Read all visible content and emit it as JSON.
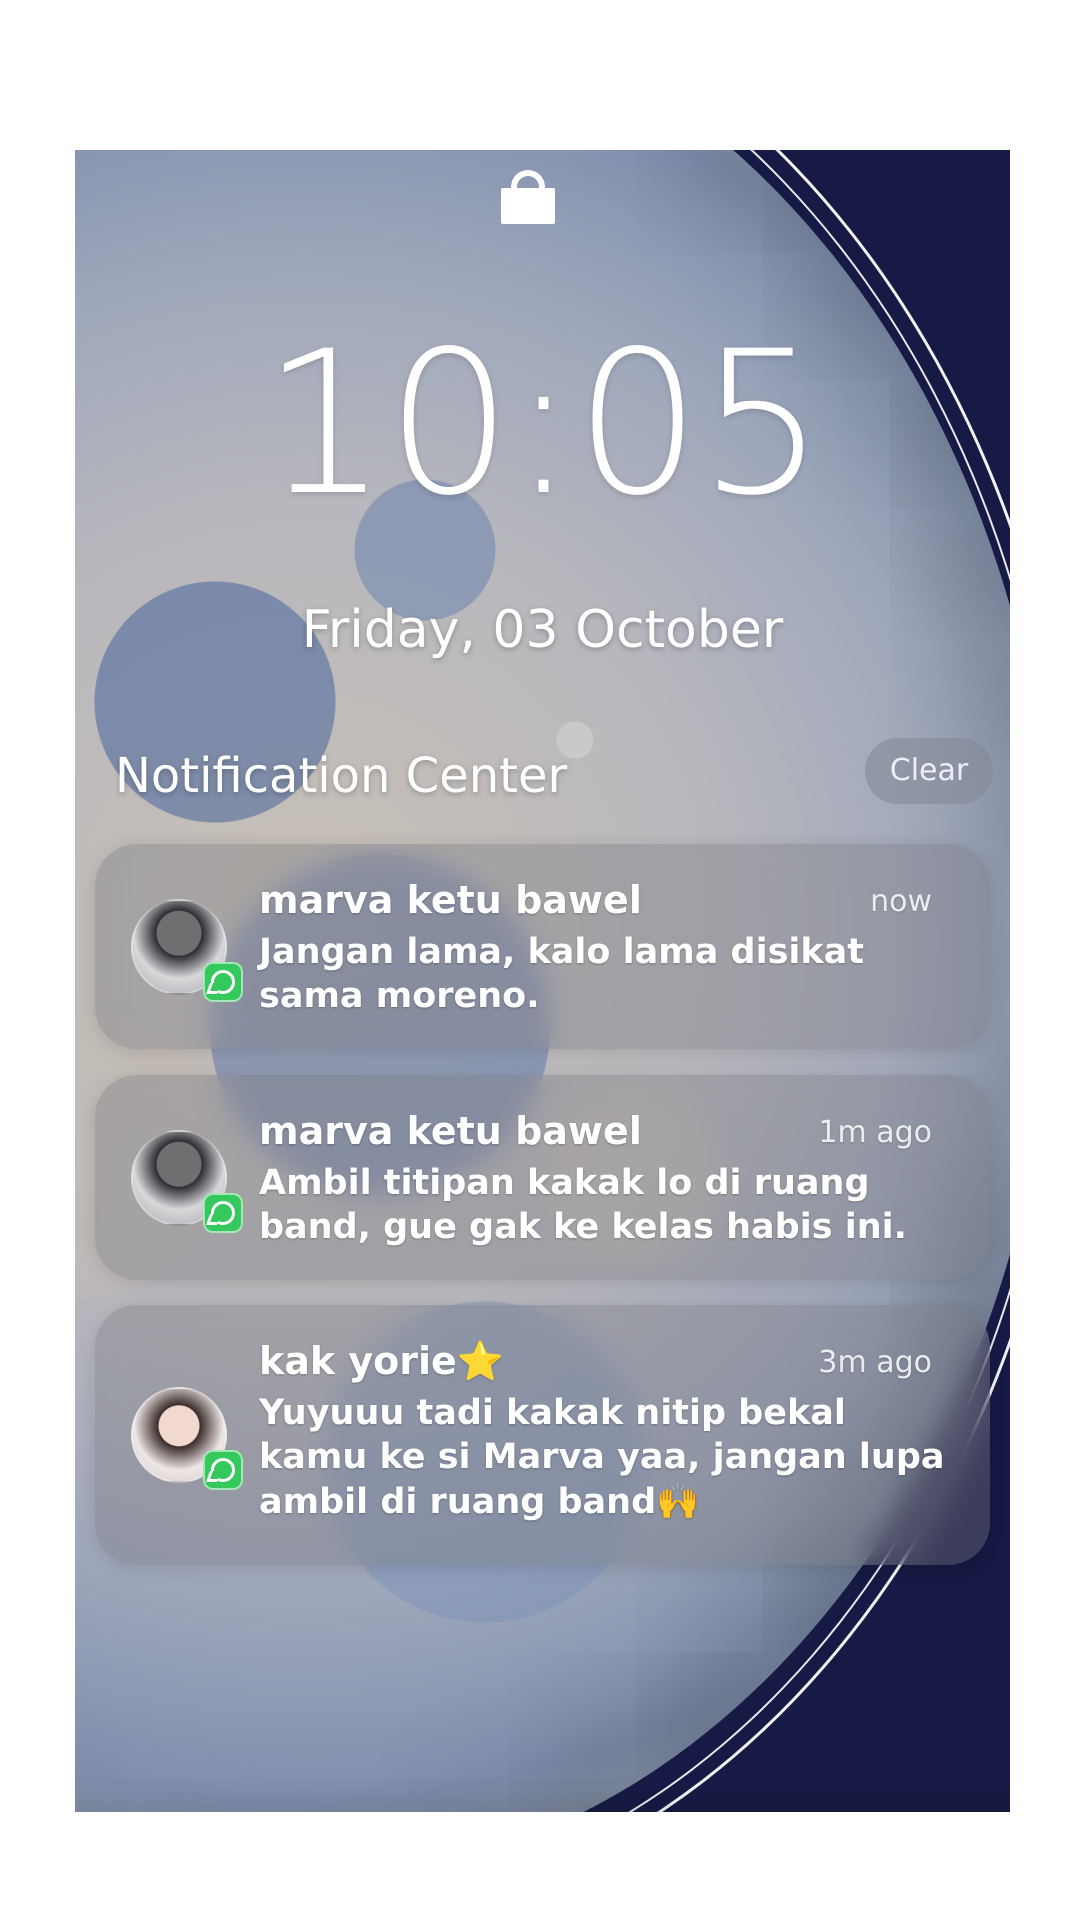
{
  "lockscreen": {
    "time": "10:05",
    "date": "Friday, 03 October"
  },
  "notification_center": {
    "title": "Notification Center",
    "clear_label": "Clear"
  },
  "notifications": [
    {
      "sender": "marva ketu bawel",
      "time_ago": "now",
      "message": "Jangan lama, kalo lama disikat sama moreno.",
      "avatar_icon": "avatar-photo",
      "app_badge_icon": "whatsapp-icon"
    },
    {
      "sender": "marva ketu bawel",
      "time_ago": "1m ago",
      "message": "Ambil titipan kakak lo di ruang band, gue gak ke kelas habis ini.",
      "avatar_icon": "avatar-photo",
      "app_badge_icon": "whatsapp-icon"
    },
    {
      "sender": "kak yorie⭐",
      "time_ago": "3m ago",
      "message": "Yuyuuu tadi kakak nitip bekal kamu ke si Marva yaa, jangan lupa ambil di ruang band🙌",
      "avatar_icon": "avatar-photo",
      "app_badge_icon": "whatsapp-icon"
    }
  ],
  "icons": {
    "lock": "lock-icon",
    "whatsapp": "whatsapp-icon"
  },
  "colors": {
    "whatsapp_green": "#35c85d",
    "night_sky": "#161a44"
  }
}
